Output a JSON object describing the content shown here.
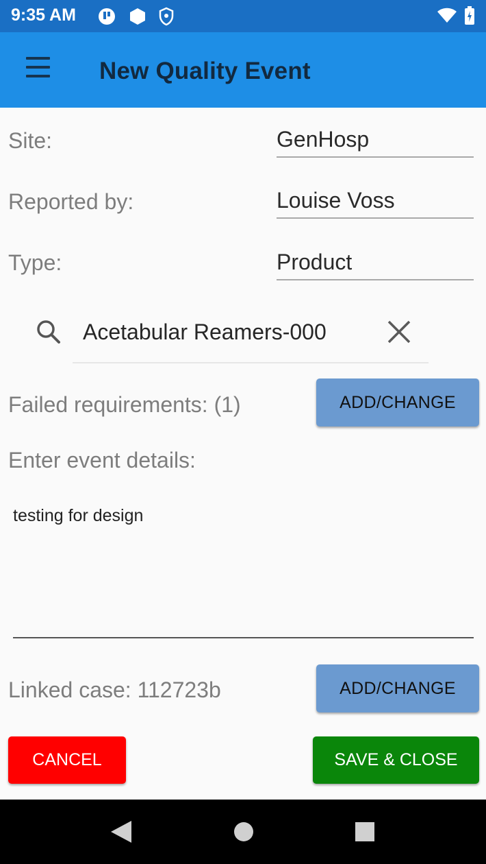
{
  "status_bar": {
    "time": "9:35 AM",
    "icons": [
      "app-notification-icon",
      "hexagon-icon",
      "shield-icon",
      "wifi-icon",
      "battery-icon"
    ]
  },
  "app_bar": {
    "title": "New Quality Event",
    "menu_icon": "hamburger-menu-icon"
  },
  "form": {
    "site_label": "Site:",
    "site_value": "GenHosp",
    "reported_by_label": "Reported by:",
    "reported_by_value": "Louise Voss",
    "type_label": "Type:",
    "type_value": "Product"
  },
  "search": {
    "value": "Acetabular Reamers-000",
    "icon": "search-icon",
    "clear_icon": "close-icon"
  },
  "failed_requirements": {
    "label": "Failed requirements: (1)",
    "button_label": "ADD/CHANGE"
  },
  "event_details": {
    "label": "Enter event details:",
    "value": "testing for design"
  },
  "linked_case": {
    "label": "Linked case: 112723b",
    "button_label": "ADD/CHANGE"
  },
  "actions": {
    "cancel_label": "CANCEL",
    "save_label": "SAVE & CLOSE"
  },
  "colors": {
    "status_bar": "#1a6fc4",
    "app_bar": "#1e8ee6",
    "button_blue": "#6b9ad0",
    "cancel": "#ff0000",
    "save": "#0a860a"
  }
}
